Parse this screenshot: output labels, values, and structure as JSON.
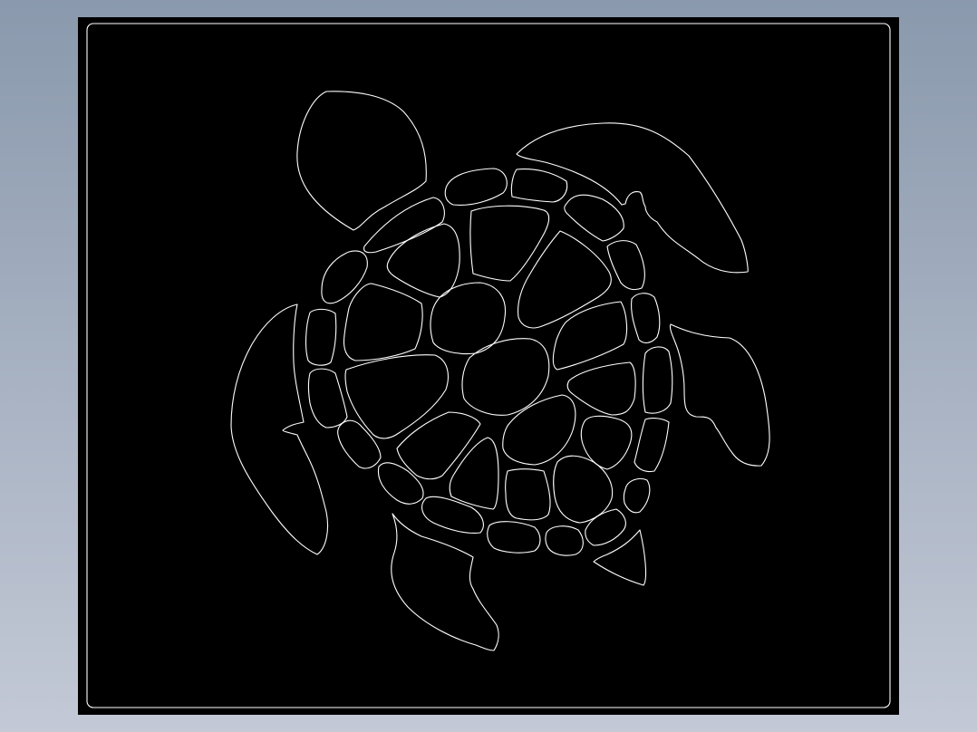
{
  "canvas": {
    "background_color": "#000000",
    "line_color": "#ffffff",
    "app_background_top": "#8a99ad",
    "app_background_bottom": "#c3c9d6"
  },
  "drawing": {
    "subject": "sea-turtle-outline"
  }
}
